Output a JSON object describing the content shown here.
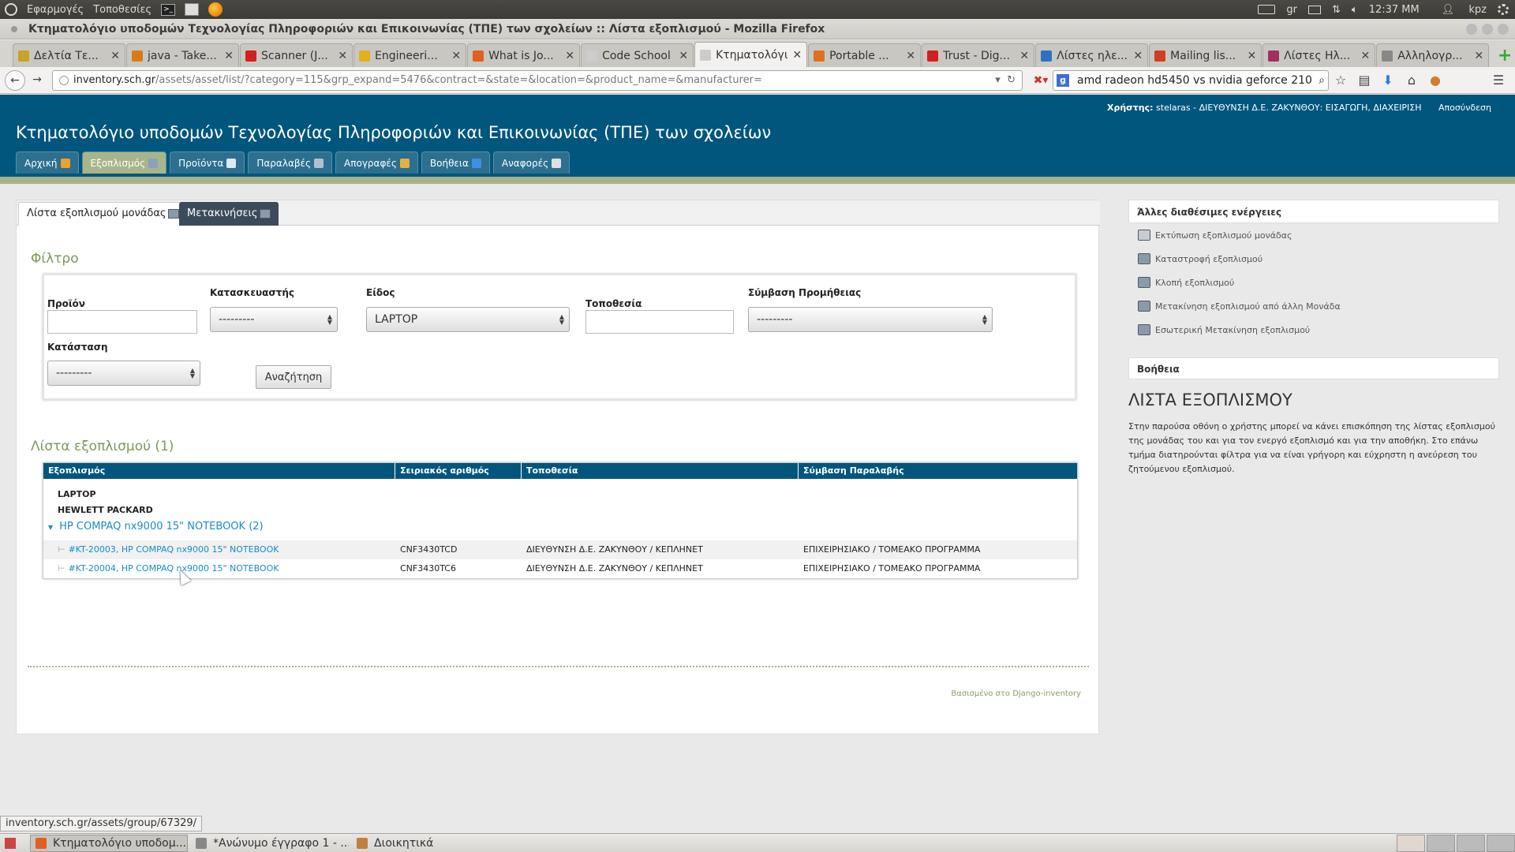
{
  "os_panel": {
    "apps_menu": "Εφαρμογές",
    "places_menu": "Τοποθεσίες",
    "keyboard_layout": "gr",
    "clock": "12:37 ΜΜ",
    "user": "kpz"
  },
  "window": {
    "title": "Κτηματολόγιο υποδομών Τεχνολογίας Πληροφοριών και Επικοινωνίας (ΤΠΕ) των σχολείων :: Λίστα εξοπλισμού - Mozilla Firefox"
  },
  "browser_tabs": [
    {
      "label": "Δελτία Τε...",
      "color": "#c9a227"
    },
    {
      "label": "java - Take...",
      "color": "#d97a1a"
    },
    {
      "label": "Scanner (J...",
      "color": "#d02020"
    },
    {
      "label": "Engineeri...",
      "color": "#e0b020"
    },
    {
      "label": "What is Jo...",
      "color": "#e06020"
    },
    {
      "label": "Code School -...",
      "color": "#cccccc"
    },
    {
      "label": "Κτηματολόγι...",
      "color": "#cccccc",
      "active": true
    },
    {
      "label": "Portable ...",
      "color": "#e07020"
    },
    {
      "label": "Trust - Dig...",
      "color": "#d02020"
    },
    {
      "label": "Λίστες ηλε...",
      "color": "#3070c0"
    },
    {
      "label": "Mailing lis...",
      "color": "#d04020"
    },
    {
      "label": "Λίστες Ηλ...",
      "color": "#a03060"
    },
    {
      "label": "Αλληλογρ...",
      "color": "#888888"
    }
  ],
  "url": {
    "host": "inventory.sch.gr",
    "path": "/assets/asset/list/?category=115&grp_expand=5476&contract=&state=&location=&product_name=&manufacturer="
  },
  "search_query": "amd radeon hd5450 vs nvidia geforce 210",
  "site": {
    "user_label": "Χρήστης:",
    "user_value": "stelaras - ΔΙΕΥΘΥΝΣΗ Δ.Ε. ΖΑΚΥΝΘΟΥ: ΕΙΣΑΓΩΓΗ, ΔΙΑΧΕΙΡΙΣΗ",
    "logout": "Αποσύνδεση",
    "title": "Κτηματολόγιο υποδομών Τεχνολογίας Πληροφοριών και Επικοινωνίας (ΤΠΕ) των σχολείων",
    "menu": [
      {
        "label": "Αρχική",
        "icon": "house-icon",
        "color": "#f0a030"
      },
      {
        "label": "Εξοπλισμός",
        "icon": "computer-icon",
        "color": "#8aa0c0",
        "active": true
      },
      {
        "label": "Προϊόντα",
        "icon": "document-icon",
        "color": "#e0e8f0"
      },
      {
        "label": "Παραλαβές",
        "icon": "truck-icon",
        "color": "#b0c0d0"
      },
      {
        "label": "Απογραφές",
        "icon": "box-icon",
        "color": "#e0b040"
      },
      {
        "label": "Βοήθεια",
        "icon": "help-icon",
        "color": "#4090e0"
      },
      {
        "label": "Αναφορές",
        "icon": "report-icon",
        "color": "#e0e0e0"
      }
    ]
  },
  "content_tabs": {
    "unit_list": "Λίστα εξοπλισμού μονάδας",
    "movements": "Μετακινήσεις"
  },
  "filter": {
    "title": "Φίλτρο",
    "product_label": "Προϊόν",
    "product_value": "",
    "manufacturer_label": "Κατασκευαστής",
    "manufacturer_value": "---------",
    "type_label": "Είδος",
    "type_value": "LAPTOP",
    "location_label": "Τοποθεσία",
    "location_value": "",
    "contract_label": "Σύμβαση Προμήθειας",
    "contract_value": "---------",
    "state_label": "Κατάσταση",
    "state_value": "---------",
    "search_button": "Αναζήτηση"
  },
  "equipment_list": {
    "title": "Λίστα εξοπλισμού (1)",
    "columns": [
      "Εξοπλισμός",
      "Σειριακός αριθμός",
      "Τοποθεσία",
      "Σύμβαση Παραλαβής"
    ],
    "group_type": "LAPTOP",
    "group_manufacturer": "HEWLETT PACKARD",
    "group_product": "HP COMPAQ nx9000 15\" NOTEBOOK (2)",
    "rows": [
      {
        "item": "#KT-20003, HP COMPAQ nx9000 15\" NOTEBOOK",
        "serial": "CNF3430TCD",
        "location": "ΔΙΕΥΘΥΝΣΗ Δ.Ε. ΖΑΚΥΝΘΟΥ / ΚΕΠΛΗΝΕΤ",
        "contract": "ΕΠΙΧΕΙΡΗΣΙΑΚΟ / ΤΟΜΕΑΚΟ ΠΡΟΓΡΑΜΜΑ"
      },
      {
        "item": "#KT-20004, HP COMPAQ nx9000 15\" NOTEBOOK",
        "serial": "CNF3430TC6",
        "location": "ΔΙΕΥΘΥΝΣΗ Δ.Ε. ΖΑΚΥΝΘΟΥ / ΚΕΠΛΗΝΕΤ",
        "contract": "ΕΠΙΧΕΙΡΗΣΙΑΚΟ / ΤΟΜΕΑΚΟ ΠΡΟΓΡΑΜΜΑ"
      }
    ]
  },
  "powered_by": "Βασισμένο στο Django-inventory",
  "sidebar": {
    "actions_title": "Άλλες διαθέσιμες ενέργειες",
    "actions": [
      {
        "label": "Εκτύπωση εξοπλισμού μονάδας",
        "icon": "printer-icon"
      },
      {
        "label": "Καταστροφή εξοπλισμού",
        "icon": "computer-icon"
      },
      {
        "label": "Κλοπή εξοπλισμού",
        "icon": "computer-icon"
      },
      {
        "label": "Μετακίνηση εξοπλισμού από άλλη Μονάδα",
        "icon": "computer-icon"
      },
      {
        "label": "Εσωτερική Μετακίνηση εξοπλισμού",
        "icon": "computer-icon"
      }
    ],
    "help_title": "Βοήθεια",
    "help_heading": "ΛΙΣΤΑ ΕΞΟΠΛΙΣΜΟΥ",
    "help_text": "Στην παρούσα οθόνη ο χρήστης μπορεί να κάνει επισκόπηση της λίστας εξοπλισμού της μονάδας του και για τον ενεργό εξοπλισμό και για την αποθήκη. Στο επάνω τμήμα διατηρούνται φίλτρα για να είναι γρήγορη και εύχρηστη η ανεύρεση του ζητούμενου εξοπλισμού."
  },
  "status_url": "inventory.sch.gr/assets/group/67329/",
  "taskbar": [
    {
      "label": "Κτηματολόγιο υποδομ...",
      "color": "#e06020",
      "active": true
    },
    {
      "label": "*Ανώνυμο έγγραφο 1 - ...",
      "color": "#888888"
    },
    {
      "label": "Διοικητικά",
      "color": "#c08040"
    }
  ]
}
